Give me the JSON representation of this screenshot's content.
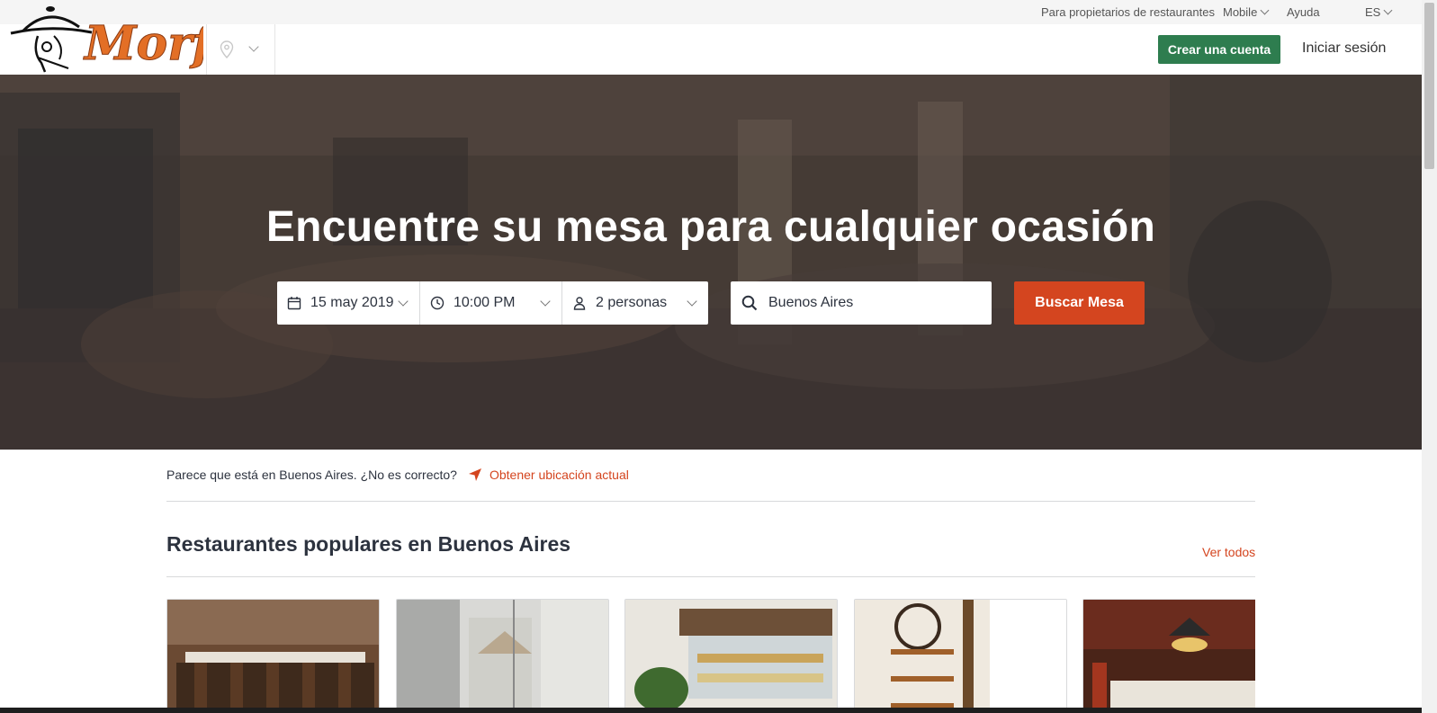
{
  "util": {
    "owners": "Para propietarios de restaurantes",
    "mobile": "Mobile",
    "help": "Ayuda",
    "lang": "ES"
  },
  "nav": {
    "logo_text": "Morfi",
    "create_account": "Crear una cuenta",
    "login": "Iniciar sesión"
  },
  "hero": {
    "title": "Encuentre su mesa para cualquier ocasión",
    "date": "15 may 2019",
    "time": "10:00 PM",
    "party": "2 personas",
    "location_value": "Buenos Aires",
    "search_button": "Buscar Mesa"
  },
  "geo": {
    "message": "Parece que está en Buenos Aires. ¿No es correcto?",
    "link": "Obtener ubicación actual"
  },
  "popular": {
    "title": "Restaurantes populares en Buenos Aires",
    "see_all": "Ver todos"
  },
  "colors": {
    "accent": "#d4451f",
    "create_button": "#2e7d4f",
    "text": "#2d333f"
  },
  "icons": [
    "location-pin-icon",
    "chevron-down-icon",
    "calendar-icon",
    "clock-icon",
    "person-icon",
    "search-icon",
    "navigation-arrow-icon"
  ]
}
